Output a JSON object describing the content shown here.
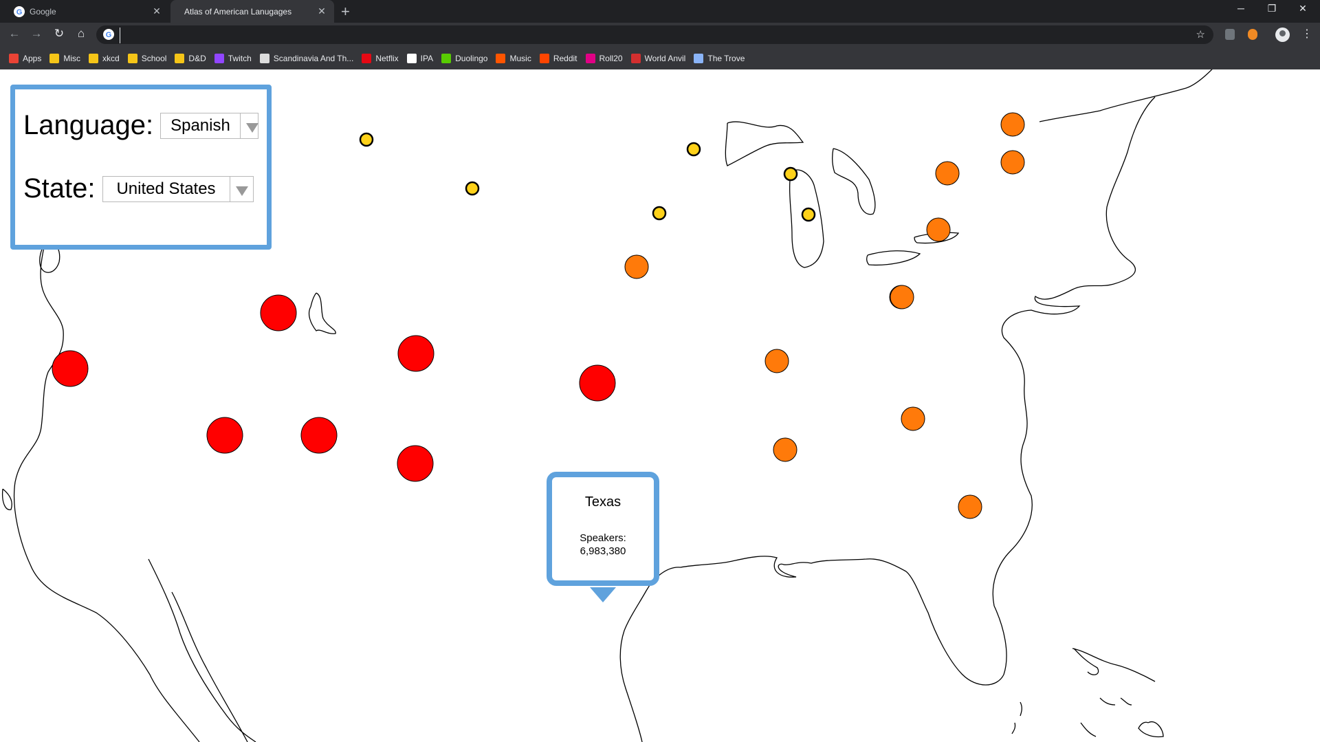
{
  "browser": {
    "tabs": [
      {
        "label": "Google",
        "active": false
      },
      {
        "label": "Atlas of American Lanugages",
        "active": true
      }
    ],
    "address_value": "",
    "bookmarks": [
      {
        "label": "Apps",
        "icon": "apps-grid-icon",
        "color": "#ea4335"
      },
      {
        "label": "Misc",
        "icon": "folder-icon",
        "color": "#f5c518"
      },
      {
        "label": "xkcd",
        "icon": "folder-icon",
        "color": "#f5c518"
      },
      {
        "label": "School",
        "icon": "folder-icon",
        "color": "#f5c518"
      },
      {
        "label": "D&D",
        "icon": "folder-icon",
        "color": "#f5c518"
      },
      {
        "label": "Twitch",
        "icon": "twitch-icon",
        "color": "#9146ff"
      },
      {
        "label": "Scandinavia And Th...",
        "icon": "comic-icon",
        "color": "#dddddd"
      },
      {
        "label": "Netflix",
        "icon": "netflix-icon",
        "color": "#e50914"
      },
      {
        "label": "IPA",
        "icon": "wikipedia-icon",
        "color": "#ffffff"
      },
      {
        "label": "Duolingo",
        "icon": "duolingo-icon",
        "color": "#58cc02"
      },
      {
        "label": "Music",
        "icon": "music-icon",
        "color": "#ff5500"
      },
      {
        "label": "Reddit",
        "icon": "reddit-icon",
        "color": "#ff4500"
      },
      {
        "label": "Roll20",
        "icon": "roll20-icon",
        "color": "#e10085"
      },
      {
        "label": "World Anvil",
        "icon": "world-anvil-icon",
        "color": "#d32f2f"
      },
      {
        "label": "The Trove",
        "icon": "trove-icon",
        "color": "#8ab4f8"
      }
    ]
  },
  "controls": {
    "language_label": "Language:",
    "language_value": "Spanish",
    "state_label": "State:",
    "state_value": "United States"
  },
  "tooltip": {
    "state": "Texas",
    "speakers_label": "Speakers:",
    "speakers_value": "6,983,380"
  },
  "colors": {
    "panel_border": "#5fa2dd",
    "high": "#ff0000",
    "medium": "#ff7a0a",
    "low": "#ffd21a"
  },
  "markers": [
    {
      "level": "medium"
    },
    {
      "level": "high"
    },
    {
      "level": "high"
    },
    {
      "level": "high"
    },
    {
      "level": "high"
    },
    {
      "level": "high"
    },
    {
      "level": "high"
    },
    {
      "level": "high"
    },
    {
      "level": "high"
    },
    {
      "level": "low"
    },
    {
      "level": "low"
    },
    {
      "level": "low"
    },
    {
      "level": "low"
    },
    {
      "level": "low"
    },
    {
      "level": "low"
    },
    {
      "level": "medium"
    },
    {
      "level": "medium"
    },
    {
      "level": "medium"
    },
    {
      "level": "medium"
    },
    {
      "level": "medium"
    },
    {
      "level": "medium"
    },
    {
      "level": "medium"
    },
    {
      "level": "medium"
    },
    {
      "level": "medium"
    },
    {
      "level": "medium"
    },
    {
      "level": "medium"
    }
  ]
}
